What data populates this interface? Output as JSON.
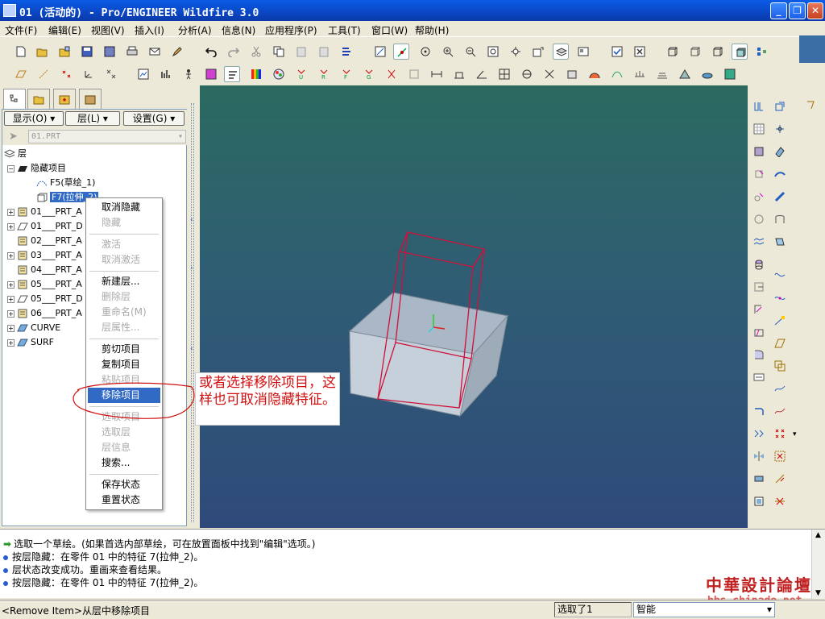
{
  "window": {
    "title": "01 (活动的) - Pro/ENGINEER Wildfire 3.0"
  },
  "menu": [
    "文件(F)",
    "编辑(E)",
    "视图(V)",
    "插入(I)",
    "分析(A)",
    "信息(N)",
    "应用程序(P)",
    "工具(T)",
    "窗口(W)",
    "帮助(H)"
  ],
  "navigator": {
    "buttons": {
      "show": "显示(O)",
      "layer": "层(L)",
      "settings": "设置(G)"
    },
    "model_selector": "01.PRT",
    "tree": {
      "root": "层",
      "hidden_group": "隐藏项目",
      "hidden_children": [
        "F5(草绘_1)",
        "F7(拉伸_2)"
      ],
      "layers": [
        "01___PRT_A",
        "01___PRT_D",
        "02___PRT_A",
        "03___PRT_A",
        "04___PRT_A",
        "05___PRT_A",
        "05___PRT_D",
        "06___PRT_A",
        "CURVE",
        "SURF"
      ]
    }
  },
  "context_menu": {
    "groups": [
      [
        {
          "label": "取消隐藏",
          "enabled": true
        },
        {
          "label": "隐藏",
          "enabled": false
        }
      ],
      [
        {
          "label": "激活",
          "enabled": false
        },
        {
          "label": "取消激活",
          "enabled": false
        }
      ],
      [
        {
          "label": "新建层...",
          "enabled": true
        },
        {
          "label": "删除层",
          "enabled": false
        },
        {
          "label": "重命名(M)",
          "enabled": false
        },
        {
          "label": "层属性...",
          "enabled": false
        }
      ],
      [
        {
          "label": "剪切项目",
          "enabled": true
        },
        {
          "label": "复制项目",
          "enabled": true
        },
        {
          "label": "粘贴项目",
          "enabled": false
        },
        {
          "label": "移除项目",
          "enabled": true,
          "highlighted": true
        }
      ],
      [
        {
          "label": "选取项目",
          "enabled": false
        },
        {
          "label": "选取层",
          "enabled": false
        },
        {
          "label": "层信息",
          "enabled": false
        },
        {
          "label": "搜索...",
          "enabled": true
        }
      ],
      [
        {
          "label": "保存状态",
          "enabled": true
        },
        {
          "label": "重置状态",
          "enabled": true
        }
      ]
    ]
  },
  "annotation": {
    "text": "或者选择移除项目，这样也可取消隐藏特征。"
  },
  "messages": [
    {
      "type": "prompt",
      "text": "选取一个草绘。(如果首选内部草绘，可在放置面板中找到\"编辑\"选项。)"
    },
    {
      "type": "info",
      "text": "按层隐藏：在零件 01 中的特征 7(拉伸_2)。"
    },
    {
      "type": "info",
      "text": "层状态改变成功。重画来查看结果。"
    },
    {
      "type": "info",
      "text": "按层隐藏：在零件 01 中的特征 7(拉伸_2)。"
    }
  ],
  "status": {
    "hint": "<Remove Item>从层中移除项目",
    "selection": "选取了1",
    "filter": "智能"
  },
  "watermark": {
    "line1": "中華設計論壇",
    "line2": "bbs.chinade.net"
  },
  "colors": {
    "highlight": "#316ac5",
    "annotation": "#d01010",
    "model_wire": "#d0103a"
  }
}
